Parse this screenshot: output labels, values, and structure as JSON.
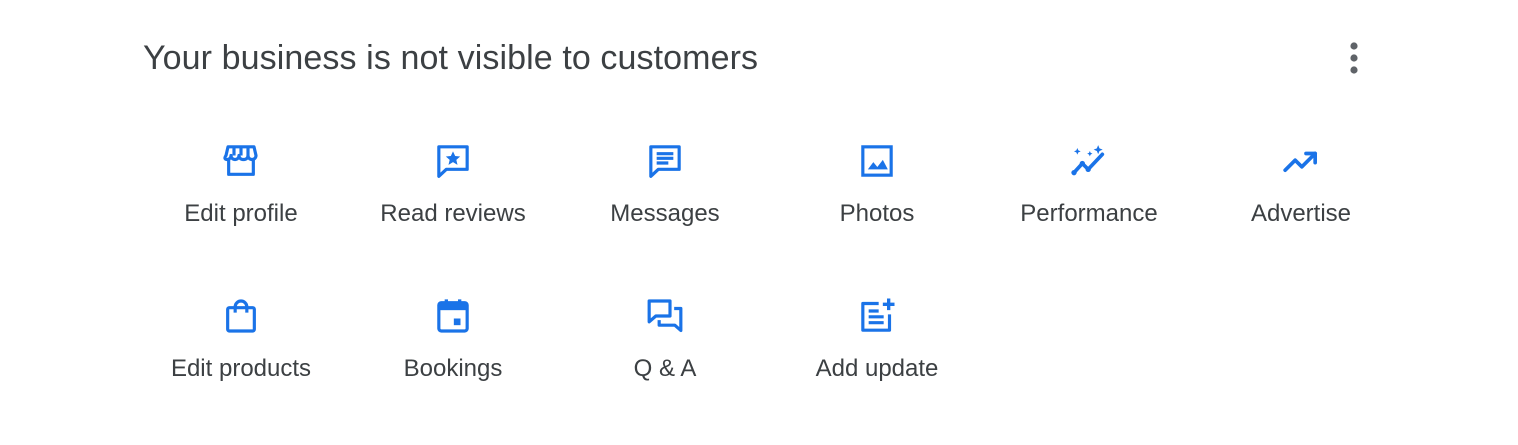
{
  "header": {
    "title": "Your business is not visible to customers",
    "more_icon": "more-vert-icon"
  },
  "accent_color": "#1a73e8",
  "text_color": "#3c4043",
  "actions": [
    {
      "label": "Edit profile",
      "icon": "storefront-icon"
    },
    {
      "label": "Read reviews",
      "icon": "reviews-icon"
    },
    {
      "label": "Messages",
      "icon": "message-icon"
    },
    {
      "label": "Photos",
      "icon": "photo-icon"
    },
    {
      "label": "Performance",
      "icon": "performance-icon"
    },
    {
      "label": "Advertise",
      "icon": "trending-up-icon"
    },
    {
      "label": "Edit products",
      "icon": "shopping-bag-icon"
    },
    {
      "label": "Bookings",
      "icon": "calendar-icon"
    },
    {
      "label": "Q & A",
      "icon": "forum-icon"
    },
    {
      "label": "Add update",
      "icon": "post-add-icon"
    }
  ]
}
